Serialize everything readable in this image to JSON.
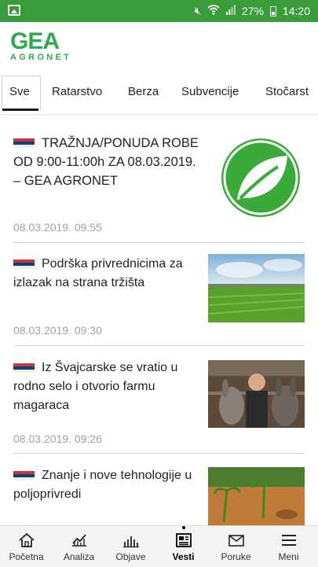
{
  "status_bar": {
    "battery": "27%",
    "time": "14:20"
  },
  "app": {
    "logo_main": "GEA",
    "logo_sub": "AGRONET",
    "brand_color": "#2fa84f"
  },
  "tabs": [
    {
      "label": "Sve"
    },
    {
      "label": "Ratarstvo"
    },
    {
      "label": "Berza"
    },
    {
      "label": "Subvencije"
    },
    {
      "label": "Stočarst"
    }
  ],
  "articles": [
    {
      "title": "TRAŽNJA/PONUDA ROBE OD 9:00-11:00h ZA 08.03.2019. – GEA AGRONET",
      "date": "08.03.2019. 09:55",
      "thumb": "gea-leaf-logo"
    },
    {
      "title": "Podrška privrednicima za izlazak na strana tržišta",
      "date": "08.03.2019. 09:30",
      "thumb": "green-field"
    },
    {
      "title": "Iz Švajcarske se vratio u rodno selo i otvorio farmu magaraca",
      "date": "08.03.2019. 09:26",
      "thumb": "donkeys-farm"
    },
    {
      "title": "Znanje i nove tehnologije u poljoprivredi",
      "date": "",
      "thumb": "seedlings"
    }
  ],
  "bottom_nav": [
    {
      "label": "Početna",
      "icon": "home-icon"
    },
    {
      "label": "Analiza",
      "icon": "chart-line-icon"
    },
    {
      "label": "Objave",
      "icon": "bars-icon"
    },
    {
      "label": "Vesti",
      "icon": "news-icon",
      "active": true
    },
    {
      "label": "Poruke",
      "icon": "mail-icon"
    },
    {
      "label": "Meni",
      "icon": "menu-icon"
    }
  ]
}
